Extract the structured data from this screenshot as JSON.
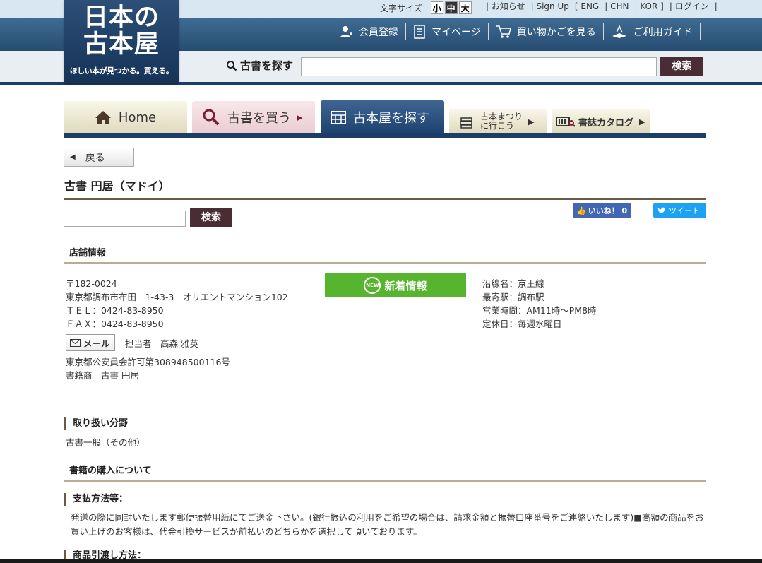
{
  "header": {
    "logo_line1": "日本の",
    "logo_line2": "古本屋",
    "logo_tagline": "ほしい本が見つかる。買える。",
    "font_size_label": "文字サイズ",
    "font_sizes": [
      "小",
      "中",
      "大"
    ],
    "top_links": [
      "| お知らせ",
      "| Sign Up",
      "[ ENG",
      "| CHN",
      "| KOR ]",
      "| ログイン",
      "|"
    ],
    "main_links": [
      "会員登録",
      "マイページ",
      "買い物かごを見る",
      "ご利用ガイド"
    ],
    "search_label": "古書を探す",
    "search_button": "検索"
  },
  "tabs": {
    "home": "Home",
    "buy": "古書を買う",
    "shop": "古本屋を探す",
    "festival_l1": "古本まつり",
    "festival_l2": "に行こう",
    "catalog": "書誌カタログ"
  },
  "page": {
    "back": "戻る",
    "title": "古書 円居（マドイ）",
    "search_button": "検索",
    "like": "いいね！ 0",
    "tweet": "ツイート"
  },
  "shop_info": {
    "heading": "店舗情報",
    "postal": "〒182-0024",
    "address": "東京都調布市布田　1-43-3　オリエントマンション102",
    "tel": "ＴＥＬ：0424-83-8950",
    "fax": "ＦＡＸ：0424-83-8950",
    "mail_button": "メール",
    "contact": "担当者　高森 雅英",
    "license": "東京都公安員会許可第308948500116号",
    "dealer": "書籍商　古書 円居",
    "dash": "-",
    "new_badge": "NEW",
    "new_info": "新着情報",
    "line": "沿線名：京王線",
    "station": "最寄駅：調布駅",
    "hours": "営業時間：AM11時～PM8時",
    "closed": "定休日：毎週水曜日"
  },
  "genre": {
    "heading": "取り扱い分野",
    "value": "古書一般（その他）"
  },
  "purchase": {
    "heading": "書籍の購入について",
    "payment_heading": "支払方法等：",
    "payment_text": "発送の際に同封いたします郵便振替用紙にてご送金下さい。(銀行振込の利用をご希望の場合は、請求金額と振替口座番号をご連絡いたします)■高額の商品をお買い上げのお客様は、代金引換サービスか前払いのどちらかを選択して頂いております。",
    "delivery_heading": "商品引渡し方法："
  }
}
